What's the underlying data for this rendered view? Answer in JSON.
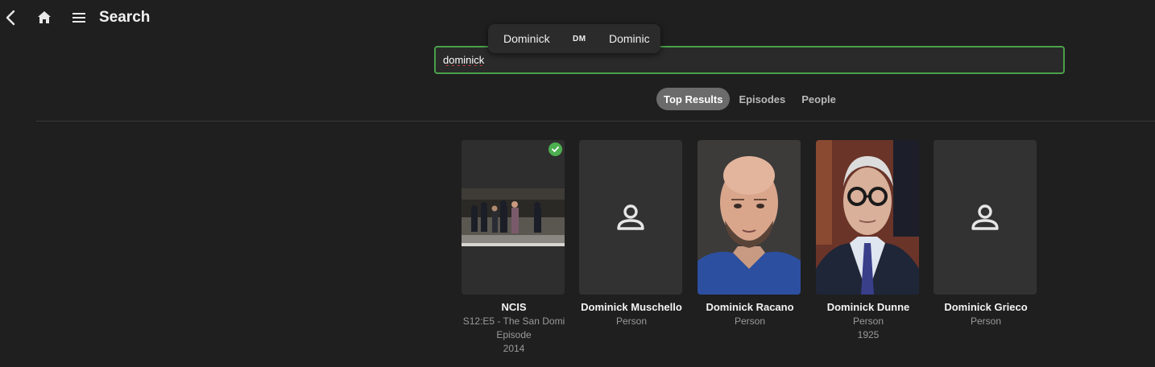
{
  "header": {
    "title": "Search",
    "back_icon": "chevron-left-icon",
    "home_icon": "home-icon",
    "menu_icon": "hamburger-menu-icon"
  },
  "ime": {
    "candidates": [
      "Dominick",
      "DM",
      "Dominic"
    ]
  },
  "search": {
    "value": "dominick"
  },
  "tabs": [
    {
      "label": "Top Results",
      "active": true
    },
    {
      "label": "Episodes",
      "active": false
    },
    {
      "label": "People",
      "active": false
    }
  ],
  "results": [
    {
      "title": "NCIS",
      "lines": [
        "S12:E5 - The San Domi",
        "Episode",
        "2014"
      ],
      "type": "episode",
      "watched": true
    },
    {
      "title": "Dominick Muschello",
      "lines": [
        "Person"
      ],
      "type": "person-placeholder"
    },
    {
      "title": "Dominick Racano",
      "lines": [
        "Person"
      ],
      "type": "person-photo"
    },
    {
      "title": "Dominick Dunne",
      "lines": [
        "Person",
        "1925"
      ],
      "type": "person-photo"
    },
    {
      "title": "Dominick Grieco",
      "lines": [
        "Person"
      ],
      "type": "person-placeholder"
    }
  ],
  "colors": {
    "background": "#1f1f1f",
    "accent_green": "#4aa04a",
    "tab_active": "#6b6b6b",
    "watched_badge": "#4caf50"
  }
}
